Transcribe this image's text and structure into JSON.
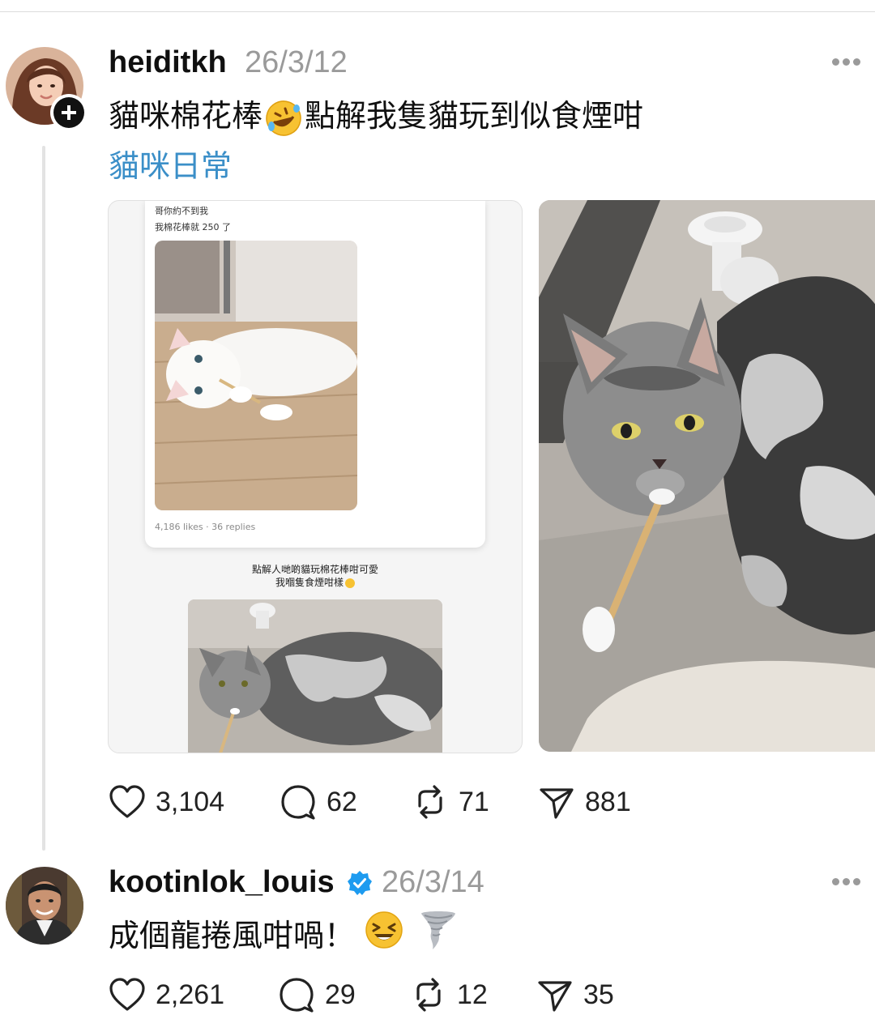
{
  "posts": [
    {
      "username": "heiditkh",
      "date": "26/3/12",
      "text_before": "貓咪棉花棒",
      "text_after": "點解我隻貓玩到似食煙咁",
      "tag": "貓咪日常",
      "embedded": {
        "caption_line1": "哥你約不到我",
        "caption_line2": "我棉花棒就 250 了",
        "stats": "4,186 likes · 36 replies",
        "quote_line1": "點解人哋啲貓玩棉花棒咁可愛",
        "quote_line2": "我嗰隻食煙咁樣"
      },
      "actions": {
        "likes": "3,104",
        "replies": "62",
        "reposts": "71",
        "shares": "881"
      }
    },
    {
      "username": "kootinlok_louis",
      "date": "26/3/14",
      "verified": true,
      "text": "成個龍捲風咁喎！",
      "actions": {
        "likes": "2,261",
        "replies": "29",
        "reposts": "12",
        "shares": "35"
      }
    }
  ],
  "icons": [
    "follow-plus-icon",
    "more-icon",
    "heart-icon",
    "comment-icon",
    "repost-icon",
    "share-icon",
    "verified-badge-icon",
    "rofl-emoji-icon",
    "laughing-emoji-icon",
    "tornado-emoji-icon"
  ],
  "colors": {
    "link": "#3b8fc8",
    "verified": "#1d9bf0",
    "muted": "#9a9a9a"
  }
}
